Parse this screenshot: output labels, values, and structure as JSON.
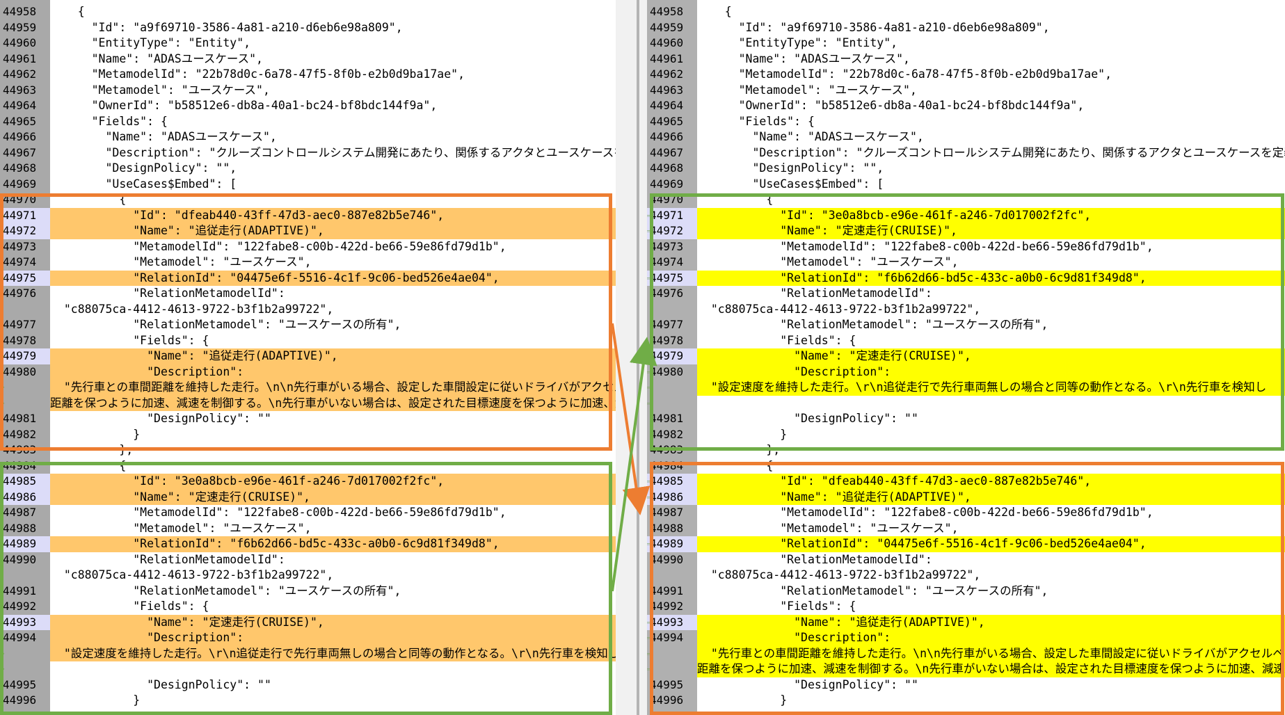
{
  "colors": {
    "orange_box": "#ed7d31",
    "green_box": "#70ad47",
    "changed_line_left": "#ffc76c",
    "changed_line_right": "#ffff00",
    "changed_chars_left": "#d27373",
    "changed_line_gutter_marker": "#dcdcf8"
  },
  "icons": {
    "merge_arrow": "left-arrow-icon",
    "diff_marker": "chevron-right-icon"
  },
  "left_lines": [
    {
      "n": "44958",
      "t": "    {"
    },
    {
      "n": "44959",
      "t": "      \"Id\": \"a9f69710-3586-4a81-a210-d6eb6e98a809\","
    },
    {
      "n": "44960",
      "t": "      \"EntityType\": \"Entity\","
    },
    {
      "n": "44961",
      "t": "      \"Name\": \"ADASユースケース\","
    },
    {
      "n": "44962",
      "t": "      \"MetamodelId\": \"22b78d0c-6a78-47f5-8f0b-e2b0d9ba17ae\","
    },
    {
      "n": "44963",
      "t": "      \"Metamodel\": \"ユースケース\","
    },
    {
      "n": "44964",
      "t": "      \"OwnerId\": \"b58512e6-db8a-40a1-bc24-bf8bdc144f9a\","
    },
    {
      "n": "44965",
      "t": "      \"Fields\": {"
    },
    {
      "n": "44966",
      "t": "        \"Name\": \"ADASユースケース\","
    },
    {
      "n": "44967",
      "t": "        \"Description\": \"クルーズコントロールシステム開発にあたり、関係するアクタとユースケースを定義す"
    },
    {
      "n": "44968",
      "t": "        \"DesignPolicy\": \"\","
    },
    {
      "n": "44969",
      "t": "        \"UseCases$Embed\": ["
    },
    {
      "n": "44970",
      "t": "          {"
    },
    {
      "n": "44971",
      "t": "            \"Id\": \"dfeab440-43ff-47d3-aec0-887e82b5e746\","
    },
    {
      "n": "44972",
      "t": "            \"Name\": \"追従走行(ADAPTIVE)\","
    },
    {
      "n": "44973",
      "t": "            \"MetamodelId\": \"122fabe8-c00b-422d-be66-59e86fd79d1b\","
    },
    {
      "n": "44974",
      "t": "            \"Metamodel\": \"ユースケース\","
    },
    {
      "n": "44975",
      "t": "            \"RelationId\": \"04475e6f-5516-4c1f-9c06-bed526e4ae04\","
    },
    {
      "n": "44976",
      "t": "            \"RelationMetamodelId\":"
    },
    {
      "n": "",
      "t": "  \"c88075ca-4412-4613-9722-b3f1b2a99722\","
    },
    {
      "n": "44977",
      "t": "            \"RelationMetamodel\": \"ユースケースの所有\","
    },
    {
      "n": "44978",
      "t": "            \"Fields\": {"
    },
    {
      "n": "44979",
      "t": "              \"Name\": \"追従走行(ADAPTIVE)\","
    },
    {
      "n": "44980",
      "t": "              \"Description\":"
    },
    {
      "n": "",
      "t": "  \"先行車との車間距離を維持した走行。\\n\\n先行車がいる場合、設定した車間設定に従いドライバがアクセルペ"
    },
    {
      "n": "",
      "t": "距離を保つように加速、減速を制御する。\\n先行車がいない場合は、設定された目標速度を保つように加速、減速"
    },
    {
      "n": "44981",
      "t": "              \"DesignPolicy\": \"\""
    },
    {
      "n": "44982",
      "t": "            }"
    },
    {
      "n": "44983",
      "t": "          },"
    },
    {
      "n": "44984",
      "t": "          {"
    },
    {
      "n": "44985",
      "t": "            \"Id\": \"3e0a8bcb-e96e-461f-a246-7d017002f2fc\","
    },
    {
      "n": "44986",
      "t": "            \"Name\": \"定速走行(CRUISE)\","
    },
    {
      "n": "44987",
      "t": "            \"MetamodelId\": \"122fabe8-c00b-422d-be66-59e86fd79d1b\","
    },
    {
      "n": "44988",
      "t": "            \"Metamodel\": \"ユースケース\","
    },
    {
      "n": "44989",
      "t": "            \"RelationId\": \"f6b62d66-bd5c-433c-a0b0-6c9d81f349d8\","
    },
    {
      "n": "44990",
      "t": "            \"RelationMetamodelId\":"
    },
    {
      "n": "",
      "t": "  \"c88075ca-4412-4613-9722-b3f1b2a99722\","
    },
    {
      "n": "44991",
      "t": "            \"RelationMetamodel\": \"ユースケースの所有\","
    },
    {
      "n": "44992",
      "t": "            \"Fields\": {"
    },
    {
      "n": "44993",
      "t": "              \"Name\": \"定速走行(CRUISE)\","
    },
    {
      "n": "44994",
      "t": "              \"Description\":"
    },
    {
      "n": "",
      "t": "  \"設定速度を維持した走行。\\r\\n追従走行で先行車両無しの場合と同等の動作となる。\\r\\n先行車を検知し"
    },
    {
      "n": "",
      "t": ""
    },
    {
      "n": "44995",
      "t": "              \"DesignPolicy\": \"\""
    },
    {
      "n": "44996",
      "t": "            }"
    }
  ],
  "right_lines": [
    {
      "n": "44958",
      "t": "    {"
    },
    {
      "n": "44959",
      "t": "      \"Id\": \"a9f69710-3586-4a81-a210-d6eb6e98a809\","
    },
    {
      "n": "44960",
      "t": "      \"EntityType\": \"Entity\","
    },
    {
      "n": "44961",
      "t": "      \"Name\": \"ADASユースケース\","
    },
    {
      "n": "44962",
      "t": "      \"MetamodelId\": \"22b78d0c-6a78-47f5-8f0b-e2b0d9ba17ae\","
    },
    {
      "n": "44963",
      "t": "      \"Metamodel\": \"ユースケース\","
    },
    {
      "n": "44964",
      "t": "      \"OwnerId\": \"b58512e6-db8a-40a1-bc24-bf8bdc144f9a\","
    },
    {
      "n": "44965",
      "t": "      \"Fields\": {"
    },
    {
      "n": "44966",
      "t": "        \"Name\": \"ADASユースケース\","
    },
    {
      "n": "44967",
      "t": "        \"Description\": \"クルーズコントロールシステム開発にあたり、関係するアクタとユースケースを定義す"
    },
    {
      "n": "44968",
      "t": "        \"DesignPolicy\": \"\","
    },
    {
      "n": "44969",
      "t": "        \"UseCases$Embed\": ["
    },
    {
      "n": "44970",
      "t": "          {"
    },
    {
      "n": "44971",
      "t": "            \"Id\": \"3e0a8bcb-e96e-461f-a246-7d017002f2fc\","
    },
    {
      "n": "44972",
      "t": "            \"Name\": \"定速走行(CRUISE)\","
    },
    {
      "n": "44973",
      "t": "            \"MetamodelId\": \"122fabe8-c00b-422d-be66-59e86fd79d1b\","
    },
    {
      "n": "44974",
      "t": "            \"Metamodel\": \"ユースケース\","
    },
    {
      "n": "44975",
      "t": "            \"RelationId\": \"f6b62d66-bd5c-433c-a0b0-6c9d81f349d8\","
    },
    {
      "n": "44976",
      "t": "            \"RelationMetamodelId\":"
    },
    {
      "n": "",
      "t": "  \"c88075ca-4412-4613-9722-b3f1b2a99722\","
    },
    {
      "n": "44977",
      "t": "            \"RelationMetamodel\": \"ユースケースの所有\","
    },
    {
      "n": "44978",
      "t": "            \"Fields\": {"
    },
    {
      "n": "44979",
      "t": "              \"Name\": \"定速走行(CRUISE)\","
    },
    {
      "n": "44980",
      "t": "              \"Description\":"
    },
    {
      "n": "",
      "t": "  \"設定速度を維持した走行。\\r\\n追従走行で先行車両無しの場合と同等の動作となる。\\r\\n先行車を検知し"
    },
    {
      "n": "",
      "t": ""
    },
    {
      "n": "44981",
      "t": "              \"DesignPolicy\": \"\""
    },
    {
      "n": "44982",
      "t": "            }"
    },
    {
      "n": "44983",
      "t": "          },"
    },
    {
      "n": "44984",
      "t": "          {"
    },
    {
      "n": "44985",
      "t": "            \"Id\": \"dfeab440-43ff-47d3-aec0-887e82b5e746\","
    },
    {
      "n": "44986",
      "t": "            \"Name\": \"追従走行(ADAPTIVE)\","
    },
    {
      "n": "44987",
      "t": "            \"MetamodelId\": \"122fabe8-c00b-422d-be66-59e86fd79d1b\","
    },
    {
      "n": "44988",
      "t": "            \"Metamodel\": \"ユースケース\","
    },
    {
      "n": "44989",
      "t": "            \"RelationId\": \"04475e6f-5516-4c1f-9c06-bed526e4ae04\","
    },
    {
      "n": "44990",
      "t": "            \"RelationMetamodelId\":"
    },
    {
      "n": "",
      "t": "  \"c88075ca-4412-4613-9722-b3f1b2a99722\","
    },
    {
      "n": "44991",
      "t": "            \"RelationMetamodel\": \"ユースケースの所有\","
    },
    {
      "n": "44992",
      "t": "            \"Fields\": {"
    },
    {
      "n": "44993",
      "t": "              \"Name\": \"追従走行(ADAPTIVE)\","
    },
    {
      "n": "44994",
      "t": "              \"Description\":"
    },
    {
      "n": "",
      "t": "  \"先行車との車間距離を維持した走行。\\n\\n先行車がいる場合、設定した車間設定に従いドライバがアクセルペ"
    },
    {
      "n": "",
      "t": "距離を保つように加速、減速を制御する。\\n先行車がいない場合は、設定された目標速度を保つように加速、減速"
    },
    {
      "n": "44995",
      "t": "              \"DesignPolicy\": \"\""
    },
    {
      "n": "44996",
      "t": "            }"
    }
  ]
}
